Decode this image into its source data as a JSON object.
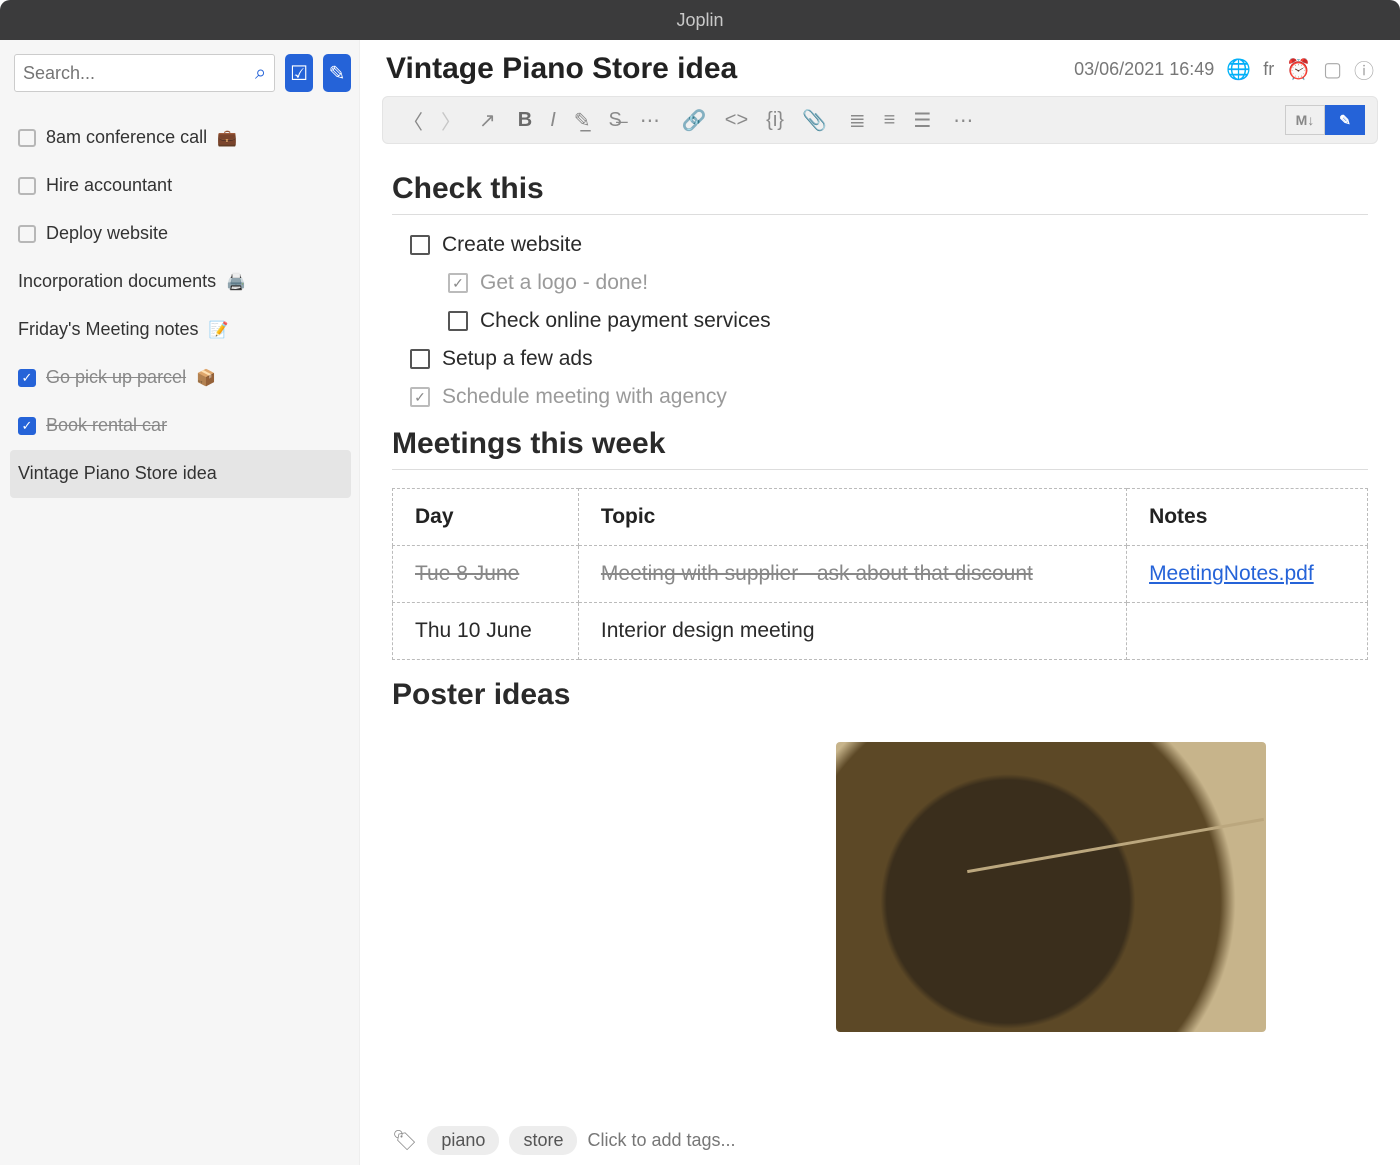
{
  "window": {
    "title": "Joplin"
  },
  "sidebar": {
    "search_placeholder": "Search...",
    "items": [
      {
        "label": "8am conference call",
        "emoji": "💼",
        "checkable": true,
        "checked": false,
        "strike": false
      },
      {
        "label": "Hire accountant",
        "emoji": "",
        "checkable": true,
        "checked": false,
        "strike": false
      },
      {
        "label": "Deploy website",
        "emoji": "",
        "checkable": true,
        "checked": false,
        "strike": false
      },
      {
        "label": "Incorporation documents",
        "emoji": "🖨️",
        "checkable": false,
        "checked": false,
        "strike": false
      },
      {
        "label": "Friday's Meeting notes",
        "emoji": "📝",
        "checkable": false,
        "checked": false,
        "strike": false
      },
      {
        "label": "Go pick up parcel",
        "emoji": "📦",
        "checkable": true,
        "checked": true,
        "strike": true
      },
      {
        "label": "Book rental car",
        "emoji": "",
        "checkable": true,
        "checked": true,
        "strike": true
      },
      {
        "label": "Vintage Piano Store idea",
        "emoji": "",
        "checkable": false,
        "checked": false,
        "strike": false,
        "selected": true
      }
    ]
  },
  "note": {
    "title": "Vintage Piano Store idea",
    "timestamp": "03/06/2021 16:49",
    "lang": "fr",
    "sections": {
      "check_title": "Check this",
      "meetings_title": "Meetings this week",
      "poster_title": "Poster ideas"
    },
    "checklist": [
      {
        "text": "Create website",
        "checked": false,
        "indent": 0,
        "done": false
      },
      {
        "text": "Get a logo - done!",
        "checked": true,
        "indent": 1,
        "done": true
      },
      {
        "text": "Check online payment services",
        "checked": false,
        "indent": 1,
        "done": false
      },
      {
        "text": "Setup a few ads",
        "checked": false,
        "indent": 0,
        "done": false
      },
      {
        "text": "Schedule meeting with agency",
        "checked": true,
        "indent": 0,
        "done": true
      }
    ],
    "table": {
      "headers": {
        "c1": "Day",
        "c2": "Topic",
        "c3": "Notes"
      },
      "rows": [
        {
          "day": "Tue 8 June",
          "topic": "Meeting with supplier - ask about that discount",
          "notes": "MeetingNotes.pdf",
          "strike": true
        },
        {
          "day": "Thu 10 June",
          "topic": "Interior design meeting",
          "notes": "",
          "strike": false
        }
      ]
    },
    "tags": {
      "existing": [
        "piano",
        "store"
      ],
      "placeholder": "Click to add tags..."
    }
  }
}
